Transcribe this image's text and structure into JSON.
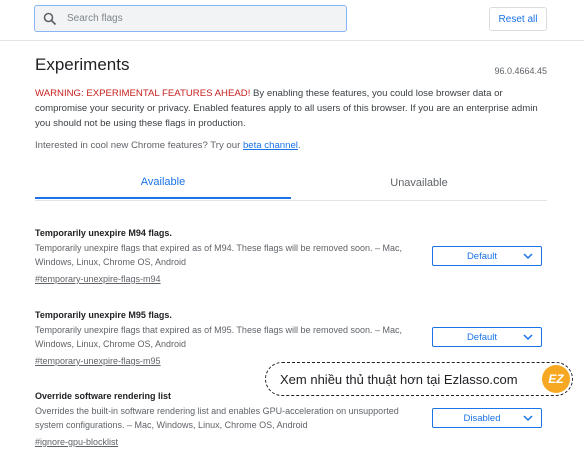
{
  "search": {
    "placeholder": "Search flags"
  },
  "toolbar": {
    "reset_label": "Reset all"
  },
  "page": {
    "title": "Experiments",
    "version": "96.0.4664.45",
    "warning_prefix": "WARNING: EXPERIMENTAL FEATURES AHEAD!",
    "warning_body": " By enabling these features, you could lose browser data or compromise your security or privacy. Enabled features apply to all users of this browser. If you are an enterprise admin you should not be using these flags in production.",
    "interest_text": "Interested in cool new Chrome features? Try our ",
    "interest_link": "beta channel",
    "interest_end": "."
  },
  "tabs": [
    {
      "label": "Available",
      "active": true
    },
    {
      "label": "Unavailable",
      "active": false
    }
  ],
  "flags": [
    {
      "title": "Temporarily unexpire M94 flags.",
      "description": "Temporarily unexpire flags that expired as of M94. These flags will be removed soon. – Mac, Windows, Linux, Chrome OS, Android",
      "link": "#temporary-unexpire-flags-m94",
      "value": "Default"
    },
    {
      "title": "Temporarily unexpire M95 flags.",
      "description": "Temporarily unexpire flags that expired as of M95. These flags will be removed soon. – Mac, Windows, Linux, Chrome OS, Android",
      "link": "#temporary-unexpire-flags-m95",
      "value": "Default"
    },
    {
      "title": "Override software rendering list",
      "description": "Overrides the built-in software rendering list and enables GPU-acceleration on unsupported system configurations. – Mac, Windows, Linux, Chrome OS, Android",
      "link": "#ignore-gpu-blocklist",
      "value": "Disabled"
    }
  ],
  "watermark": {
    "text": "Xem nhiều thủ thuật hơn tại Ezlasso.com",
    "logo": "EZ"
  },
  "colors": {
    "accent": "#1a73e8",
    "warning": "#c5221f",
    "logo": "#f7a823"
  },
  "icons": {
    "search": "search-icon",
    "chevron": "chevron-down-icon"
  }
}
